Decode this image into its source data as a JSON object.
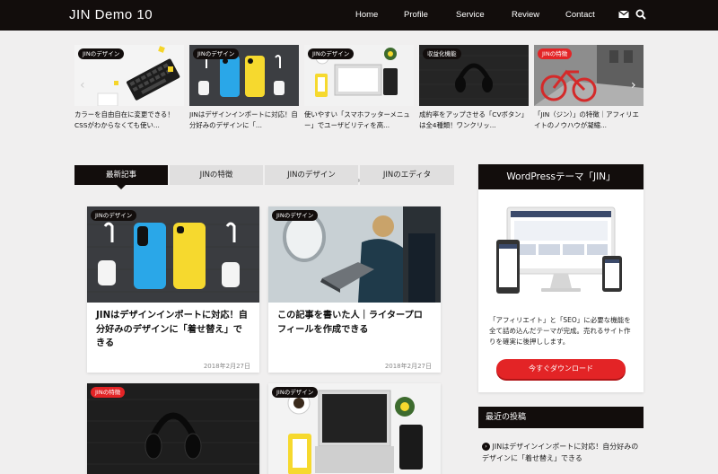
{
  "header": {
    "logo": "JIN Demo 10",
    "nav": [
      "Home",
      "Profile",
      "Service",
      "Review",
      "Contact"
    ],
    "icons": [
      "mail-icon",
      "search-icon"
    ]
  },
  "slider": {
    "items": [
      {
        "tag": "JINのデザイン",
        "title": "カラーを自由自在に変更できる！CSSがわからなくても使い..."
      },
      {
        "tag": "JINのデザイン",
        "title": "JINはデザインインポートに対応！自分好みのデザインに「..."
      },
      {
        "tag": "JINのデザイン",
        "title": "使いやすい「スマホフッターメニュー」でユーザビリティを高..."
      },
      {
        "tag": "収益化機能",
        "title": "成約率をアップさせる「CVボタン」は全4種類！ワンクリッ..."
      },
      {
        "tag": "JINの特徴",
        "title": "「JIN（ジン）」の特徴｜アフィリエイトのノウハウが凝縮..."
      }
    ],
    "prev_arrow": "‹",
    "next_arrow": "›",
    "dots_total": 5,
    "active_dot": 4
  },
  "tabs": [
    "最新記事",
    "JINの特徴",
    "JINのデザイン",
    "JINのエディタ"
  ],
  "cards": [
    {
      "tag": "JINのデザイン",
      "title": "JINはデザインインポートに対応！自分好みのデザインに「着せ替え」できる",
      "date": "2018年2月27日"
    },
    {
      "tag": "JINのデザイン",
      "title": "この記事を書いた人｜ライタープロフィールを作成できる",
      "date": "2018年2月27日"
    },
    {
      "tag": "JINの特徴",
      "title": "",
      "date": ""
    },
    {
      "tag": "JINのデザイン",
      "title": "",
      "date": ""
    }
  ],
  "sidebar": {
    "widget_title": "WordPressテーマ「JIN」",
    "description": "「アフィリエイト」と「SEO」に必要な機能を全て詰め込んだテーマが完成。売れるサイト作りを確実に後押しします。",
    "button": "今すぐダウンロード",
    "recent_title": "最近の投稿",
    "recent_item": "JINはデザインインポートに対応！自分好みのデザインに「着せ替え」できる"
  },
  "colors": {
    "accent": "#e32426",
    "header": "#120d0c",
    "background": "#f0efef"
  }
}
